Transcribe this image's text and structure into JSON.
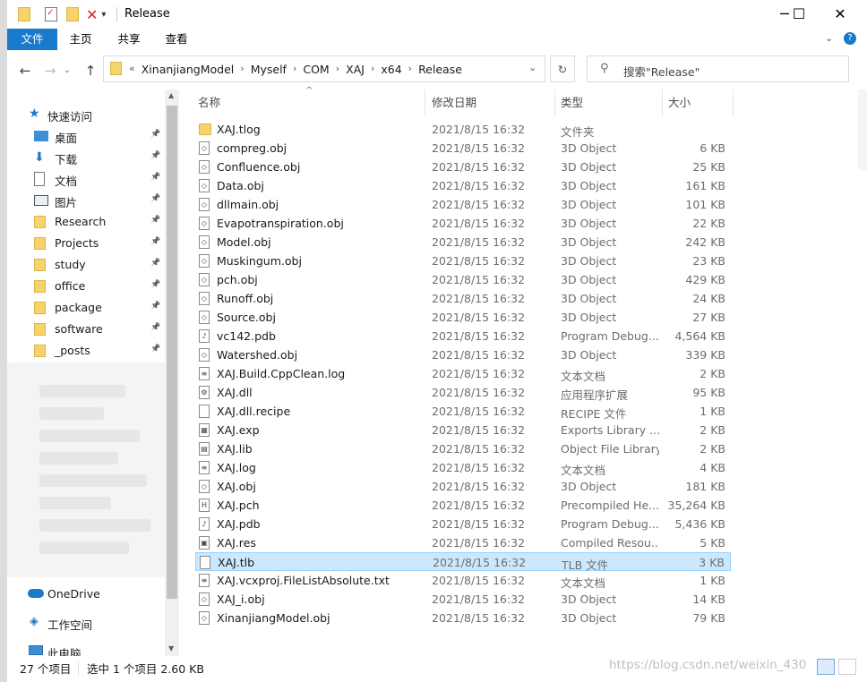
{
  "window": {
    "title": "Release",
    "controls": {
      "minimize": "─",
      "maximize": "☐",
      "close": "✕"
    }
  },
  "ribbon": {
    "tabs": [
      "文件",
      "主页",
      "共享",
      "查看"
    ]
  },
  "address": {
    "overflow": "«",
    "crumbs": [
      "XinanjiangModel",
      "Myself",
      "COM",
      "XAJ",
      "x64",
      "Release"
    ],
    "search_placeholder": "搜索\"Release\""
  },
  "nav": {
    "quick_access": "快速访问",
    "items": [
      {
        "label": "桌面",
        "icon": "desktop-icon",
        "pinned": true
      },
      {
        "label": "下载",
        "icon": "download-icon",
        "pinned": true
      },
      {
        "label": "文档",
        "icon": "document-icon",
        "pinned": true
      },
      {
        "label": "图片",
        "icon": "picture-icon",
        "pinned": true
      },
      {
        "label": "Research",
        "icon": "folder-icon",
        "pinned": true
      },
      {
        "label": "Projects",
        "icon": "folder-icon",
        "pinned": true
      },
      {
        "label": "study",
        "icon": "folder-icon",
        "pinned": true
      },
      {
        "label": "office",
        "icon": "folder-icon",
        "pinned": true
      },
      {
        "label": "package",
        "icon": "folder-icon",
        "pinned": true
      },
      {
        "label": "software",
        "icon": "folder-icon",
        "pinned": true
      },
      {
        "label": "_posts",
        "icon": "folder-icon",
        "pinned": true
      }
    ],
    "onedrive": "OneDrive",
    "workspace": "工作空间",
    "this_pc": "此电脑"
  },
  "columns": {
    "name": "名称",
    "date": "修改日期",
    "type": "类型",
    "size": "大小"
  },
  "files": [
    {
      "name": "XAJ.tlog",
      "date": "2021/8/15 16:32",
      "type": "文件夹",
      "size": "",
      "icon": "folder-icon"
    },
    {
      "name": "compreg.obj",
      "date": "2021/8/15 16:32",
      "type": "3D Object",
      "size": "6 KB",
      "icon": "3d-object-icon"
    },
    {
      "name": "Confluence.obj",
      "date": "2021/8/15 16:32",
      "type": "3D Object",
      "size": "25 KB",
      "icon": "3d-object-icon"
    },
    {
      "name": "Data.obj",
      "date": "2021/8/15 16:32",
      "type": "3D Object",
      "size": "161 KB",
      "icon": "3d-object-icon"
    },
    {
      "name": "dllmain.obj",
      "date": "2021/8/15 16:32",
      "type": "3D Object",
      "size": "101 KB",
      "icon": "3d-object-icon"
    },
    {
      "name": "Evapotranspiration.obj",
      "date": "2021/8/15 16:32",
      "type": "3D Object",
      "size": "22 KB",
      "icon": "3d-object-icon"
    },
    {
      "name": "Model.obj",
      "date": "2021/8/15 16:32",
      "type": "3D Object",
      "size": "242 KB",
      "icon": "3d-object-icon"
    },
    {
      "name": "Muskingum.obj",
      "date": "2021/8/15 16:32",
      "type": "3D Object",
      "size": "23 KB",
      "icon": "3d-object-icon"
    },
    {
      "name": "pch.obj",
      "date": "2021/8/15 16:32",
      "type": "3D Object",
      "size": "429 KB",
      "icon": "3d-object-icon"
    },
    {
      "name": "Runoff.obj",
      "date": "2021/8/15 16:32",
      "type": "3D Object",
      "size": "24 KB",
      "icon": "3d-object-icon"
    },
    {
      "name": "Source.obj",
      "date": "2021/8/15 16:32",
      "type": "3D Object",
      "size": "27 KB",
      "icon": "3d-object-icon"
    },
    {
      "name": "vc142.pdb",
      "date": "2021/8/15 16:32",
      "type": "Program Debug...",
      "size": "4,564 KB",
      "icon": "pdb-icon"
    },
    {
      "name": "Watershed.obj",
      "date": "2021/8/15 16:32",
      "type": "3D Object",
      "size": "339 KB",
      "icon": "3d-object-icon"
    },
    {
      "name": "XAJ.Build.CppClean.log",
      "date": "2021/8/15 16:32",
      "type": "文本文档",
      "size": "2 KB",
      "icon": "text-file-icon"
    },
    {
      "name": "XAJ.dll",
      "date": "2021/8/15 16:32",
      "type": "应用程序扩展",
      "size": "95 KB",
      "icon": "dll-icon"
    },
    {
      "name": "XAJ.dll.recipe",
      "date": "2021/8/15 16:32",
      "type": "RECIPE 文件",
      "size": "1 KB",
      "icon": "blank-file-icon"
    },
    {
      "name": "XAJ.exp",
      "date": "2021/8/15 16:32",
      "type": "Exports Library ...",
      "size": "2 KB",
      "icon": "exp-icon"
    },
    {
      "name": "XAJ.lib",
      "date": "2021/8/15 16:32",
      "type": "Object File Library",
      "size": "2 KB",
      "icon": "lib-icon"
    },
    {
      "name": "XAJ.log",
      "date": "2021/8/15 16:32",
      "type": "文本文档",
      "size": "4 KB",
      "icon": "text-file-icon"
    },
    {
      "name": "XAJ.obj",
      "date": "2021/8/15 16:32",
      "type": "3D Object",
      "size": "181 KB",
      "icon": "3d-object-icon"
    },
    {
      "name": "XAJ.pch",
      "date": "2021/8/15 16:32",
      "type": "Precompiled He...",
      "size": "35,264 KB",
      "icon": "pch-icon"
    },
    {
      "name": "XAJ.pdb",
      "date": "2021/8/15 16:32",
      "type": "Program Debug...",
      "size": "5,436 KB",
      "icon": "pdb-icon"
    },
    {
      "name": "XAJ.res",
      "date": "2021/8/15 16:32",
      "type": "Compiled Resou...",
      "size": "5 KB",
      "icon": "res-icon"
    },
    {
      "name": "XAJ.tlb",
      "date": "2021/8/15 16:32",
      "type": "TLB 文件",
      "size": "3 KB",
      "icon": "blank-file-icon",
      "selected": true
    },
    {
      "name": "XAJ.vcxproj.FileListAbsolute.txt",
      "date": "2021/8/15 16:32",
      "type": "文本文档",
      "size": "1 KB",
      "icon": "text-file-icon"
    },
    {
      "name": "XAJ_i.obj",
      "date": "2021/8/15 16:32",
      "type": "3D Object",
      "size": "14 KB",
      "icon": "3d-object-icon"
    },
    {
      "name": "XinanjiangModel.obj",
      "date": "2021/8/15 16:32",
      "type": "3D Object",
      "size": "79 KB",
      "icon": "3d-object-icon"
    }
  ],
  "status": {
    "count": "27 个项目",
    "selection": "选中 1 个项目  2.60 KB"
  },
  "watermark": "https://blog.csdn.net/weixin_430",
  "colors": {
    "accent": "#1979ca",
    "selection_bg": "#cce8ff",
    "selection_border": "#99d1ff",
    "folder": "#f7d46b"
  }
}
